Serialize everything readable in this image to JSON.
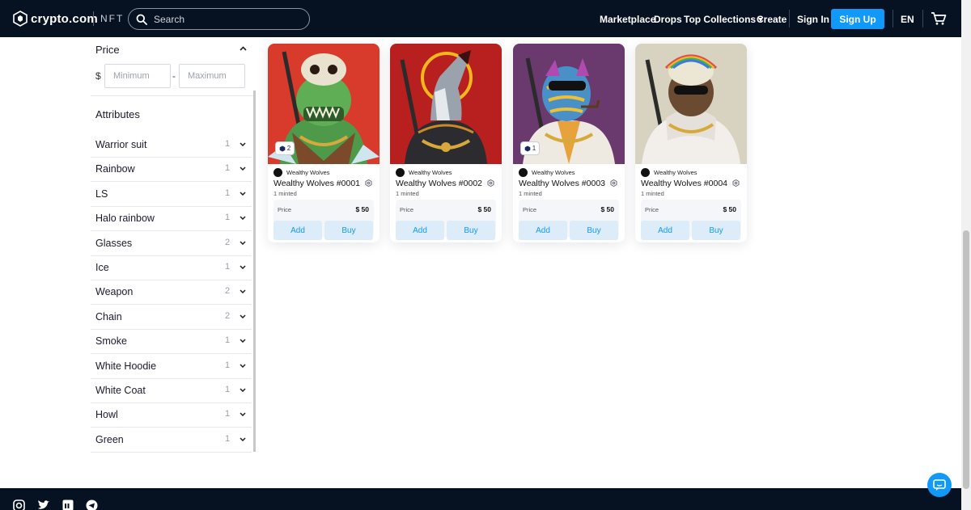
{
  "header": {
    "brand": "crypto.com",
    "product": "NFT",
    "search_placeholder": "Search",
    "nav": {
      "marketplace": "Marketplace",
      "drops": "Drops",
      "top_collections": "Top Collections",
      "create": "Create",
      "sign_in": "Sign In",
      "sign_up": "Sign Up",
      "language": "EN"
    }
  },
  "filters": {
    "price": {
      "title": "Price",
      "currency": "$",
      "min_placeholder": "Minimum",
      "max_placeholder": "Maximum",
      "separator": "-"
    },
    "attributes_title": "Attributes",
    "attributes": [
      {
        "label": "Warrior suit",
        "count": "1"
      },
      {
        "label": "Rainbow",
        "count": "1"
      },
      {
        "label": "LS",
        "count": "1"
      },
      {
        "label": "Halo rainbow",
        "count": "1"
      },
      {
        "label": "Glasses",
        "count": "2"
      },
      {
        "label": "Ice",
        "count": "1"
      },
      {
        "label": "Weapon",
        "count": "2"
      },
      {
        "label": "Chain",
        "count": "2"
      },
      {
        "label": "Smoke",
        "count": "1"
      },
      {
        "label": "White Hoodie",
        "count": "1"
      },
      {
        "label": "White Coat",
        "count": "1"
      },
      {
        "label": "Howl",
        "count": "1"
      },
      {
        "label": "Green",
        "count": "1"
      }
    ]
  },
  "cards": [
    {
      "collection": "Wealthy Wolves",
      "title": "Wealthy Wolves #0001",
      "minted": "1 minted",
      "price_label": "Price",
      "price": "$ 50",
      "badge": "2",
      "add": "Add",
      "buy": "Buy"
    },
    {
      "collection": "Wealthy Wolves",
      "title": "Wealthy Wolves #0002",
      "minted": "1 minted",
      "price_label": "Price",
      "price": "$ 50",
      "badge": "",
      "add": "Add",
      "buy": "Buy"
    },
    {
      "collection": "Wealthy Wolves",
      "title": "Wealthy Wolves #0003",
      "minted": "1 minted",
      "price_label": "Price",
      "price": "$ 50",
      "badge": "1",
      "add": "Add",
      "buy": "Buy"
    },
    {
      "collection": "Wealthy Wolves",
      "title": "Wealthy Wolves #0004",
      "minted": "1 minted",
      "price_label": "Price",
      "price": "$ 50",
      "badge": "",
      "add": "Add",
      "buy": "Buy"
    }
  ],
  "colors": {
    "header_bg": "#061121",
    "accent": "#1199fa",
    "button_bg": "#dcecf8",
    "card_bg_1": "#d83a2b",
    "card_bg_2": "#b81f1f",
    "card_bg_3": "#6a3a6e",
    "card_bg_4": "#d8d2c0"
  },
  "icons": {
    "logo": "crypto-com-lion-shield-icon",
    "search": "magnifier-icon",
    "cart": "shopping-cart-icon",
    "footer": [
      "instagram-icon",
      "twitter-icon",
      "linkedin-icon",
      "telegram-icon"
    ],
    "chat": "chat-bubble-icon"
  }
}
